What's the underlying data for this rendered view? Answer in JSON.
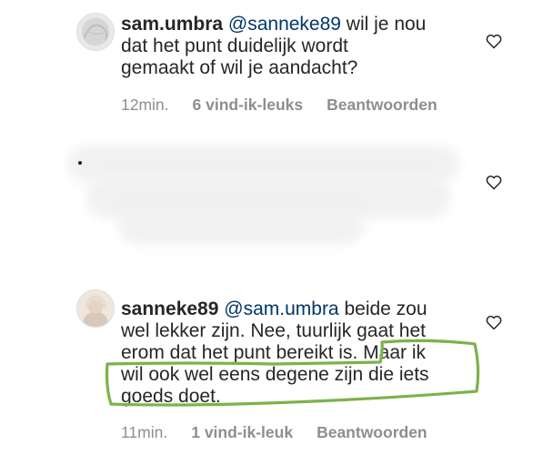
{
  "comments": [
    {
      "username": "sam.umbra",
      "line1_mention": "@sanneke89",
      "line1_rest": " wil je nou",
      "line2": "dat het punt duidelijk wordt",
      "line3": "gemaakt of wil je aandacht?",
      "time": "12min.",
      "likes": "6 vind-ik-leuks",
      "reply": "Beantwoorden",
      "like_icon": "heart-outline-icon"
    },
    {
      "redacted": true,
      "like_icon": "heart-outline-icon"
    },
    {
      "username": "sanneke89",
      "line1_mention": "@sam.umbra",
      "line1_rest": " beide zou",
      "line2": "wel lekker zijn. Nee, tuurlijk gaat het",
      "line3": "erom dat het punt bereikt is. Maar ik",
      "line4": "wil ook wel eens degene zijn die iets",
      "line5": "goeds doet.",
      "time": "11min.",
      "likes": "1 vind-ik-leuk",
      "reply": "Beantwoorden",
      "like_icon": "heart-outline-icon"
    }
  ],
  "colors": {
    "text": "#262626",
    "mention": "#00376b",
    "meta": "#8e8e8e",
    "highlight": "#7bb34a"
  }
}
